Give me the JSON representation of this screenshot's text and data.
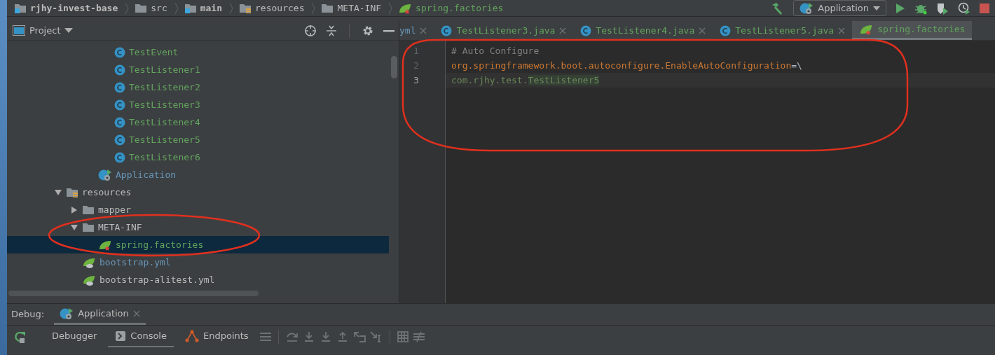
{
  "breadcrumbs": [
    {
      "label": "rjhy-invest-base",
      "kind": "module",
      "bold": true
    },
    {
      "label": "src",
      "kind": "folder",
      "bold": false
    },
    {
      "label": "main",
      "kind": "module",
      "bold": true
    },
    {
      "label": "resources",
      "kind": "resources-folder",
      "bold": false
    },
    {
      "label": "META-INF",
      "kind": "folder",
      "bold": false
    },
    {
      "label": "spring.factories",
      "kind": "spring-config",
      "bold": false,
      "color": "#62a35e"
    }
  ],
  "run_config": {
    "label": "Application"
  },
  "project_panel": {
    "title": "Project",
    "tree": [
      {
        "children": [
          {
            "children": [
              {
                "children": [
                  {
                    "label": "TestEvent",
                    "kind": "class",
                    "color": "#62a35e",
                    "selected": false
                  },
                  {
                    "label": "TestListener1",
                    "kind": "class",
                    "color": "#62a35e",
                    "selected": false
                  },
                  {
                    "label": "TestListener2",
                    "kind": "class",
                    "color": "#62a35e",
                    "selected": false
                  },
                  {
                    "label": "TestListener3",
                    "kind": "class",
                    "color": "#62a35e",
                    "selected": false
                  },
                  {
                    "label": "TestListener4",
                    "kind": "class",
                    "color": "#62a35e",
                    "selected": false
                  },
                  {
                    "label": "TestListener5",
                    "kind": "class",
                    "color": "#62a35e",
                    "selected": false
                  },
                  {
                    "label": "TestListener6",
                    "kind": "class",
                    "color": "#62a35e",
                    "selected": false
                  }
                ]
              },
              {
                "label": "Application",
                "kind": "spring-app",
                "color": "#6897bb",
                "selected": false
              }
            ]
          }
        ]
      },
      {
        "label": "resources",
        "kind": "resources-folder",
        "selected": false,
        "expanded": true,
        "children": [
          {
            "label": "mapper",
            "kind": "folder",
            "selected": false,
            "expanded": false
          },
          {
            "label": "META-INF",
            "kind": "folder",
            "selected": false,
            "expanded": true,
            "children": [
              {
                "label": "spring.factories",
                "kind": "spring-config",
                "color": "#62a35e",
                "selected": true
              }
            ]
          },
          {
            "label": "bootstrap.yml",
            "kind": "spring-yml",
            "color": "#6897bb",
            "selected": false
          },
          {
            "label": "bootstrap-alitest.yml",
            "kind": "spring-yml",
            "selected": false
          }
        ]
      }
    ]
  },
  "editor_tabs": [
    {
      "label": "yml",
      "kind": "none",
      "color": "#6897bb",
      "selected": false
    },
    {
      "label": "TestListener3.java",
      "kind": "class",
      "color": "#62a35e",
      "selected": false
    },
    {
      "label": "TestListener4.java",
      "kind": "class",
      "color": "#62a35e",
      "selected": false
    },
    {
      "label": "TestListener5.java",
      "kind": "class",
      "color": "#62a35e",
      "selected": false
    },
    {
      "label": "spring.factories",
      "kind": "spring-config",
      "color": "#62a35e",
      "selected": true
    }
  ],
  "editor": {
    "lines": [
      {
        "number": "1",
        "current": false,
        "tokens": [
          {
            "text": "# Auto Configure",
            "kind": "comment"
          }
        ]
      },
      {
        "number": "2",
        "current": false,
        "tokens": [
          {
            "text": "org.springframework.boot.autoconfigure.EnableAutoConfiguration",
            "kind": "key"
          },
          {
            "text": "=\\",
            "kind": "plain"
          }
        ]
      },
      {
        "number": "3",
        "current": true,
        "tokens": [
          {
            "text": "com.rjhy.test.",
            "kind": "value"
          },
          {
            "text": "TestListener5",
            "kind": "highlight"
          }
        ]
      }
    ]
  },
  "debug_panel": {
    "label": "Debug:",
    "tabs": [
      {
        "label": "Application",
        "selected": true
      }
    ],
    "subtabs": [
      {
        "label": "Debugger",
        "kind": "none",
        "selected": false
      },
      {
        "label": "Console",
        "kind": "console",
        "selected": true
      },
      {
        "label": "Endpoints",
        "kind": "endpoints",
        "selected": false
      }
    ]
  },
  "annotations": [
    {
      "color": "#e0301e"
    },
    {
      "color": "#e0301e"
    }
  ]
}
